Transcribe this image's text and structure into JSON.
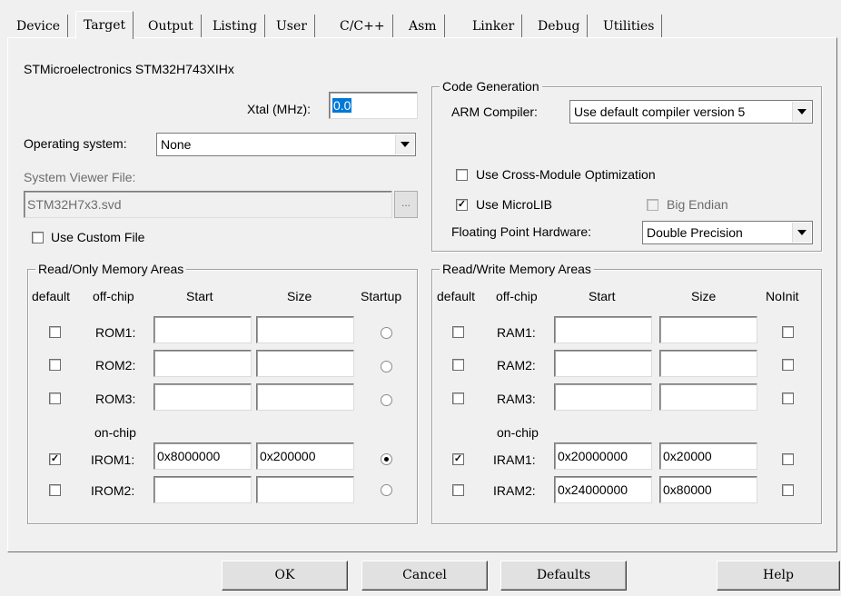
{
  "tabs": [
    "Device",
    "Target",
    "Output",
    "Listing",
    "User",
    "C/C++",
    "Asm",
    "Linker",
    "Debug",
    "Utilities"
  ],
  "device_name": "STMicroelectronics STM32H743XIHx",
  "xtal": {
    "label": "Xtal (MHz):",
    "value": "0.0"
  },
  "os": {
    "label": "Operating system:",
    "value": "None"
  },
  "svf": {
    "label": "System Viewer File:",
    "value": "STM32H7x3.svd",
    "browse": "...",
    "custom": "Use Custom File"
  },
  "codegen": {
    "title": "Code Generation",
    "compiler_label": "ARM Compiler:",
    "compiler_value": "Use default compiler version 5",
    "cross_module": "Use Cross-Module Optimization",
    "microlib": "Use MicroLIB",
    "big_endian": "Big Endian",
    "fph_label": "Floating Point Hardware:",
    "fph_value": "Double Precision"
  },
  "rom": {
    "title": "Read/Only Memory Areas",
    "headers": {
      "default": "default",
      "offchip": "off-chip",
      "start": "Start",
      "size": "Size",
      "startup": "Startup"
    },
    "onchip": "on-chip",
    "rows": [
      {
        "label": "ROM1:",
        "start": "",
        "size": "",
        "default": false,
        "startup": false
      },
      {
        "label": "ROM2:",
        "start": "",
        "size": "",
        "default": false,
        "startup": false
      },
      {
        "label": "ROM3:",
        "start": "",
        "size": "",
        "default": false,
        "startup": false
      },
      {
        "label": "IROM1:",
        "start": "0x8000000",
        "size": "0x200000",
        "default": true,
        "startup": true
      },
      {
        "label": "IROM2:",
        "start": "",
        "size": "",
        "default": false,
        "startup": false
      }
    ]
  },
  "ram": {
    "title": "Read/Write Memory Areas",
    "headers": {
      "default": "default",
      "offchip": "off-chip",
      "start": "Start",
      "size": "Size",
      "noinit": "NoInit"
    },
    "onchip": "on-chip",
    "rows": [
      {
        "label": "RAM1:",
        "start": "",
        "size": "",
        "default": false,
        "noinit": false
      },
      {
        "label": "RAM2:",
        "start": "",
        "size": "",
        "default": false,
        "noinit": false
      },
      {
        "label": "RAM3:",
        "start": "",
        "size": "",
        "default": false,
        "noinit": false
      },
      {
        "label": "IRAM1:",
        "start": "0x20000000",
        "size": "0x20000",
        "default": true,
        "noinit": false
      },
      {
        "label": "IRAM2:",
        "start": "0x24000000",
        "size": "0x80000",
        "default": false,
        "noinit": false
      }
    ]
  },
  "buttons": {
    "ok": "OK",
    "cancel": "Cancel",
    "defaults": "Defaults",
    "help": "Help"
  },
  "check_mark": "✓"
}
